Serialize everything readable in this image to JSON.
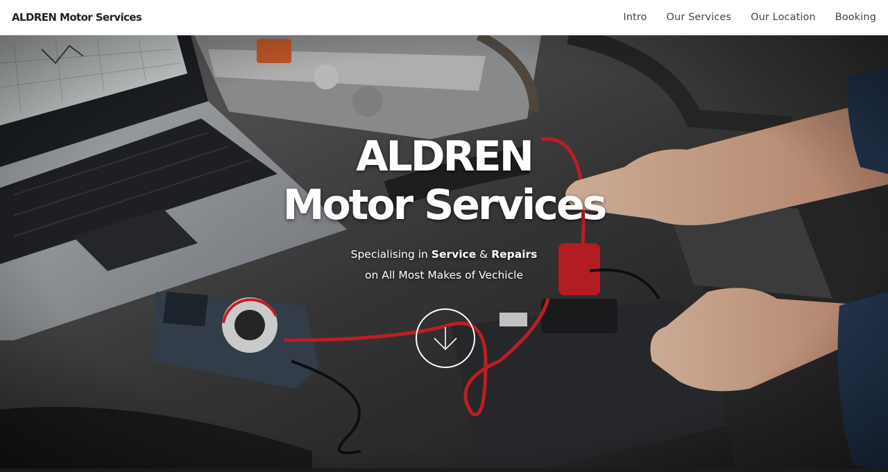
{
  "navbar": {
    "brand": "ALDREN Motor Services",
    "links": [
      "Intro",
      "Our Services",
      "Our Location",
      "Booking"
    ]
  },
  "hero": {
    "title_line1": "ALDREN",
    "title_line2": "Motor Services",
    "sub_prefix": "Specialising in ",
    "sub_service": "Service",
    "sub_amp": " & ",
    "sub_repairs": "Repairs",
    "sub_line2": "on All Most Makes of Vechicle",
    "scroll_icon": "arrow-down-circle-icon",
    "background": "car-engine-diagnostics-photo"
  }
}
